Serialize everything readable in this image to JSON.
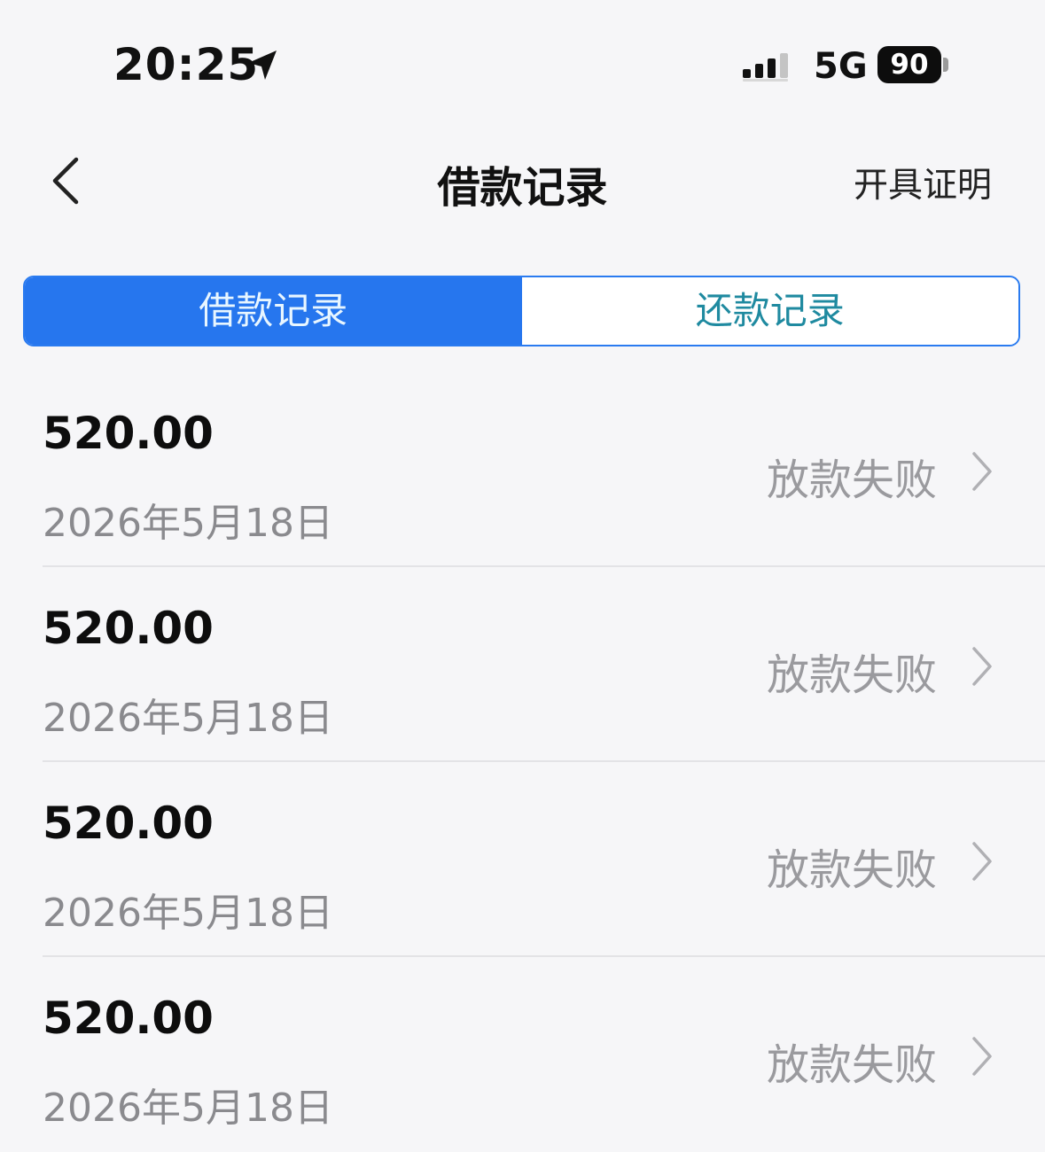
{
  "status_bar": {
    "time": "20:25",
    "network": "5G",
    "battery": "90",
    "icons": [
      "location-arrow-icon",
      "signal-icon",
      "battery-icon"
    ]
  },
  "nav": {
    "title": "借款记录",
    "action": "开具证明",
    "back_icon": "chevron-left-icon"
  },
  "tabs": [
    {
      "label": "借款记录",
      "active": true
    },
    {
      "label": "还款记录",
      "active": false
    }
  ],
  "records": [
    {
      "amount": "520.00",
      "date": "2026年5月18日",
      "status": "放款失败"
    },
    {
      "amount": "520.00",
      "date": "2026年5月18日",
      "status": "放款失败"
    },
    {
      "amount": "520.00",
      "date": "2026年5月18日",
      "status": "放款失败"
    },
    {
      "amount": "520.00",
      "date": "2026年5月18日",
      "status": "放款失败"
    }
  ],
  "colors": {
    "accent": "#2676ee",
    "inactive_tab_text": "#1f8aa0",
    "muted_text": "#8a8a8e",
    "background": "#f6f6f8"
  }
}
